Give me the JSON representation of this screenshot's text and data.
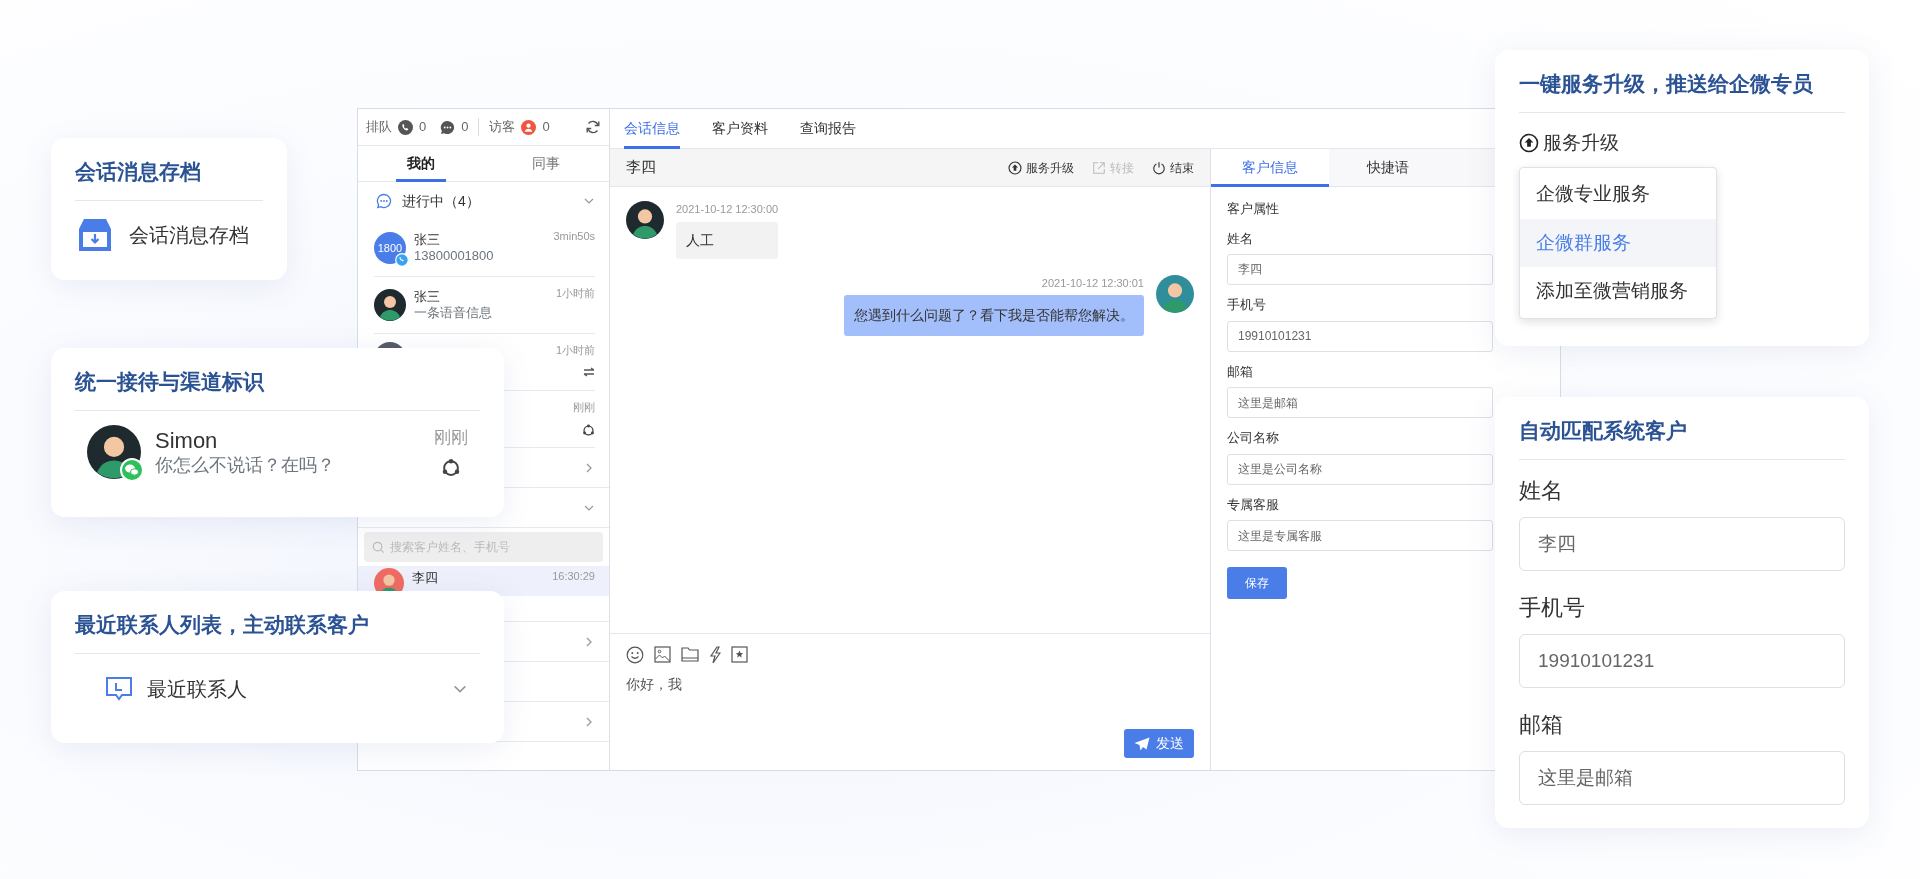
{
  "app": {
    "queue_bar": {
      "queue_label": "排队",
      "phone_count": "0",
      "chat_count": "0",
      "visitor_label": "访客",
      "visitor_count": "0"
    },
    "list_tabs": [
      {
        "label": "我的",
        "selected": true
      },
      {
        "label": "同事",
        "selected": false
      }
    ],
    "group": {
      "label": "进行中（4）",
      "expanded": true
    },
    "conversations": [
      {
        "kind": "full",
        "avatar_text": "1800",
        "badge": true,
        "name": "张三",
        "preview": "13800001800",
        "time": "3min50s"
      },
      {
        "kind": "full",
        "name": "张三",
        "preview": "一条语音信息",
        "time": "1小时前"
      },
      {
        "kind": "transfer",
        "time": "1小时前"
      },
      {
        "kind": "ring",
        "time": "刚刚"
      }
    ],
    "sections": [
      {
        "kind": "group",
        "expanded": false
      },
      {
        "kind": "group",
        "expanded": true
      },
      {
        "kind": "search",
        "placeholder": "搜索客户姓名、手机号"
      },
      {
        "kind": "contact",
        "name": "李四",
        "time": "16:30:29",
        "selected": true
      },
      {
        "kind": "group",
        "expanded": false
      },
      {
        "kind": "blank"
      },
      {
        "kind": "group",
        "expanded": false
      }
    ],
    "chat_tabs": [
      {
        "label": "会话信息",
        "selected": true
      },
      {
        "label": "客户资料",
        "selected": false
      },
      {
        "label": "查询报告",
        "selected": false
      }
    ],
    "chat_header": {
      "title": "李四",
      "actions": [
        {
          "kind": "upgrade",
          "label": "服务升级",
          "disabled": false
        },
        {
          "kind": "transfer",
          "label": "转接",
          "disabled": true
        },
        {
          "kind": "end",
          "label": "结束",
          "disabled": false
        }
      ]
    },
    "messages": [
      {
        "kind": "incoming",
        "time": "2021-10-12 12:30:00",
        "text": "人工"
      },
      {
        "kind": "outgoing",
        "time": "2021-10-12 12:30:01",
        "text": "您遇到什么问题了？看下我是否能帮您解决。"
      }
    ],
    "composer": {
      "tools": [
        {
          "kind": "emoji"
        },
        {
          "kind": "image"
        },
        {
          "kind": "folder"
        },
        {
          "kind": "bolt"
        },
        {
          "kind": "star"
        }
      ],
      "value": "你好，我",
      "send": "发送"
    },
    "info_tabs": [
      {
        "label": "客户信息",
        "selected": true
      },
      {
        "label": "快捷语",
        "selected": false
      }
    ],
    "info": {
      "section": "客户属性",
      "fields": [
        {
          "label": "姓名",
          "value": "李四"
        },
        {
          "label": "手机号",
          "value": "19910101231"
        },
        {
          "label": "邮箱",
          "placeholder": "这里是邮箱"
        },
        {
          "label": "公司名称",
          "placeholder": "这里是公司名称"
        },
        {
          "label": "专属客服",
          "placeholder": "这里是专属客服"
        }
      ],
      "save": "保存"
    }
  },
  "left_cards": [
    {
      "kind": "archive",
      "title": "会话消息存档",
      "item": "会话消息存档"
    },
    {
      "kind": "contact",
      "title": "统一接待与渠道标识",
      "name": "Simon",
      "message": "你怎么不说话？在吗？",
      "time": "刚刚"
    },
    {
      "kind": "recent",
      "title": "最近联系人列表，主动联系客户",
      "item": "最近联系人"
    }
  ],
  "upgrade_card": {
    "title": "一键服务升级，推送给企微专员",
    "trigger": "服务升级",
    "menu": [
      {
        "label": "企微专业服务",
        "selected": false
      },
      {
        "label": "企微群服务",
        "selected": true
      },
      {
        "label": "添加至微营销服务",
        "selected": false
      }
    ]
  },
  "match_card": {
    "title": "自动匹配系统客户",
    "fields": [
      {
        "label": "姓名",
        "value": "李四"
      },
      {
        "label": "手机号",
        "value": "19910101231"
      },
      {
        "label": "邮箱",
        "placeholder": "这里是邮箱"
      }
    ]
  }
}
